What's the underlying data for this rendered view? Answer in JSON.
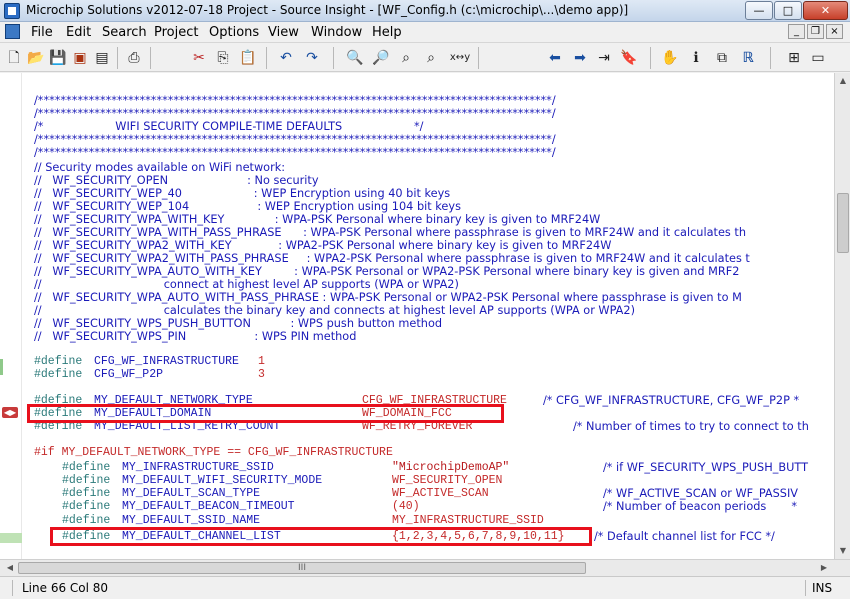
{
  "window": {
    "title": "Microchip Solutions v2012-07-18 Project - Source Insight - [WF_Config.h (c:\\microchip\\...\\demo app)]",
    "minimize_glyph": "—",
    "maximize_glyph": "□",
    "close_glyph": "✕"
  },
  "menu": {
    "items": [
      "File",
      "Edit",
      "Search",
      "Project",
      "Options",
      "View",
      "Window",
      "Help"
    ],
    "mdi_minimize": "_",
    "mdi_restore": "❐",
    "mdi_close": "×"
  },
  "toolbar": {
    "icons": [
      "new-file-icon",
      "open-folder-icon",
      "save-icon",
      "save-all-icon",
      "close-file-icon",
      "print-icon",
      "cut-icon",
      "copy-icon",
      "paste-icon",
      "undo-icon",
      "redo-icon",
      "search-icon",
      "search-files-icon",
      "search-forward-icon",
      "search-backward-icon",
      "replace-icon",
      "back-icon",
      "forward-icon",
      "jump-to-line-icon",
      "bookmark-icon",
      "browse-symbol-icon",
      "symbol-info-icon",
      "references-icon",
      "relations-icon",
      "window-tile-icon",
      "window-split-icon"
    ],
    "x_y_label": "x↔y"
  },
  "code": {
    "lines": [
      "/*******************************************************************************************/",
      "/*******************************************************************************************/",
      "/*                    WIFI SECURITY COMPILE-TIME DEFAULTS                    */",
      "/*******************************************************************************************/",
      "/*******************************************************************************************/",
      "// Security modes available on WiFi network:",
      "//   WF_SECURITY_OPEN                      : No security",
      "//   WF_SECURITY_WEP_40                    : WEP Encryption using 40 bit keys",
      "//   WF_SECURITY_WEP_104                   : WEP Encryption using 104 bit keys",
      "//   WF_SECURITY_WPA_WITH_KEY              : WPA-PSK Personal where binary key is given to MRF24W",
      "//   WF_SECURITY_WPA_WITH_PASS_PHRASE      : WPA-PSK Personal where passphrase is given to MRF24W and it calculates th",
      "//   WF_SECURITY_WPA2_WITH_KEY             : WPA2-PSK Personal where binary key is given to MRF24W",
      "//   WF_SECURITY_WPA2_WITH_PASS_PHRASE     : WPA2-PSK Personal where passphrase is given to MRF24W and it calculates t",
      "//   WF_SECURITY_WPA_AUTO_WITH_KEY         : WPA-PSK Personal or WPA2-PSK Personal where binary key is given and MRF2",
      "//                                  connect at highest level AP supports (WPA or WPA2)",
      "//   WF_SECURITY_WPA_AUTO_WITH_PASS_PHRASE : WPA-PSK Personal or WPA2-PSK Personal where passphrase is given to M",
      "//                                  calculates the binary key and connects at highest level AP supports (WPA or WPA2)",
      "//   WF_SECURITY_WPS_PUSH_BUTTON           : WPS push button method",
      "//   WF_SECURITY_WPS_PIN                   : WPS PIN method"
    ],
    "defines1": [
      {
        "kw": "#define",
        "name": "CFG_WF_INFRASTRUCTURE",
        "value": "1"
      },
      {
        "kw": "#define",
        "name": "CFG_WF_P2P",
        "value": "3"
      }
    ],
    "defines2": [
      {
        "kw": "#define",
        "name": "MY_DEFAULT_NETWORK_TYPE",
        "value": "CFG_WF_INFRASTRUCTURE",
        "comment": "/* CFG_WF_INFRASTRUCTURE, CFG_WF_P2P *"
      },
      {
        "kw": "#define",
        "name": "MY_DEFAULT_DOMAIN",
        "value": "WF_DOMAIN_FCC",
        "comment": ""
      },
      {
        "kw": "#define",
        "name": "MY_DEFAULT_LIST_RETRY_COUNT",
        "value": "WF_RETRY_FOREVER",
        "comment": "/* Number of times to try to connect to th"
      }
    ],
    "if_line": "#if MY_DEFAULT_NETWORK_TYPE == CFG_WF_INFRASTRUCTURE",
    "defines3": [
      {
        "kw": "#define",
        "name": "MY_INFRASTRUCTURE_SSID",
        "value": "\"MicrochipDemoAP\"",
        "comment": "/* if WF_SECURITY_WPS_PUSH_BUTT"
      },
      {
        "kw": "#define",
        "name": "MY_DEFAULT_WIFI_SECURITY_MODE",
        "value": "WF_SECURITY_OPEN",
        "comment": ""
      },
      {
        "kw": "#define",
        "name": "MY_DEFAULT_SCAN_TYPE",
        "value": "WF_ACTIVE_SCAN",
        "comment": "/* WF_ACTIVE_SCAN or WF_PASSIV"
      },
      {
        "kw": "#define",
        "name": "MY_DEFAULT_BEACON_TIMEOUT",
        "value": "(40)",
        "comment": "/* Number of beacon periods       *"
      },
      {
        "kw": "#define",
        "name": "MY_DEFAULT_SSID_NAME",
        "value": "MY_INFRASTRUCTURE_SSID",
        "comment": ""
      },
      {
        "kw": "#define",
        "name": "MY_DEFAULT_CHANNEL_LIST",
        "value": "{1,2,3,4,5,6,7,8,9,10,11}",
        "comment": "/* Default channel list for FCC */"
      }
    ]
  },
  "scrollbar": {
    "up": "▲",
    "down": "▼",
    "left": "◀",
    "right": "▶",
    "grip": "III"
  },
  "statusbar": {
    "position": "Line 66  Col 80",
    "mode": "INS"
  },
  "colors": {
    "highlight_border": "#e8101c",
    "comment": "#1a1ab8",
    "define_value": "#c42a2a"
  }
}
